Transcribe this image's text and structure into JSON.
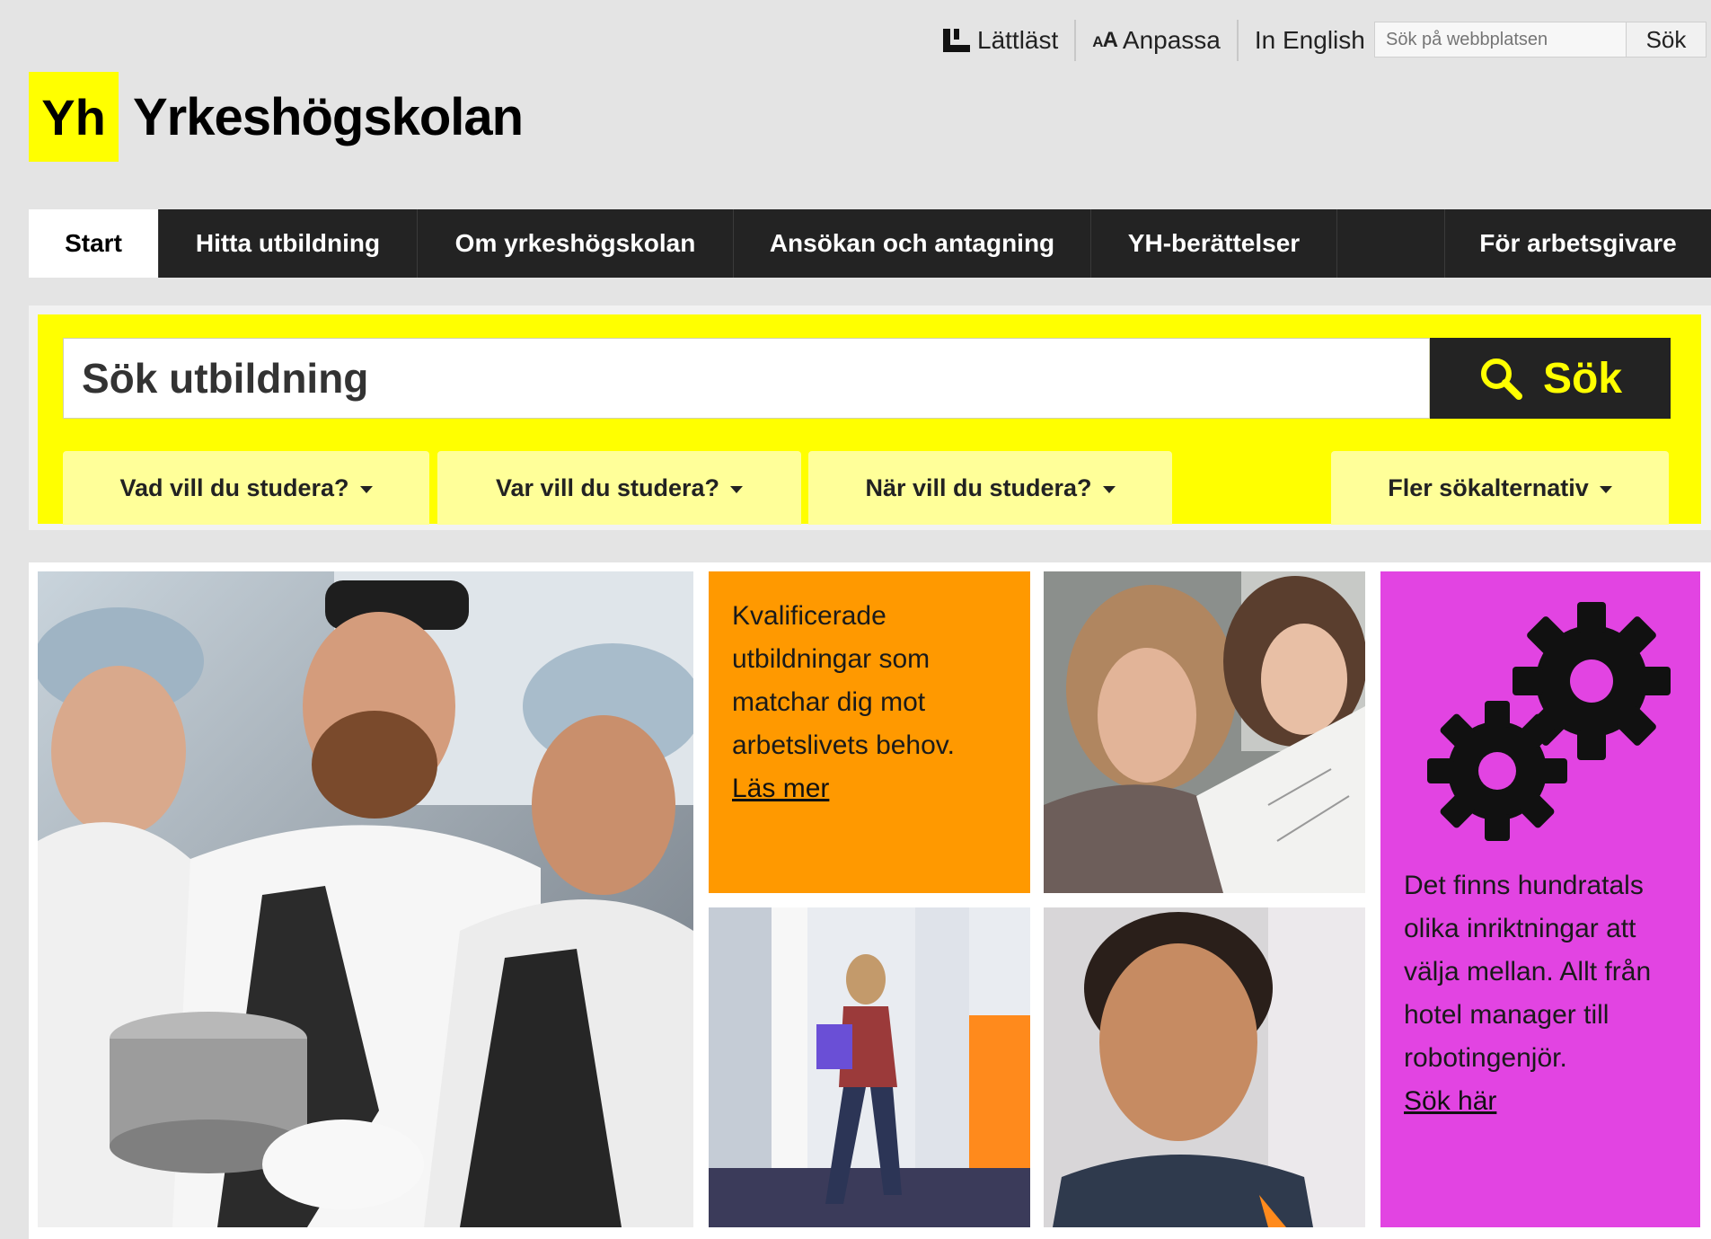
{
  "utility": {
    "easy_read": "Lättläst",
    "customize_prefix": "AA",
    "customize": "Anpassa",
    "english": "In English",
    "site_search_placeholder": "Sök på webbplatsen",
    "site_search_button": "Sök"
  },
  "logo": {
    "mark": "Yh",
    "name": "Yrkeshögskolan"
  },
  "nav": {
    "items": [
      {
        "label": "Start"
      },
      {
        "label": "Hitta utbildning"
      },
      {
        "label": "Om yrkeshögskolan"
      },
      {
        "label": "Ansökan och antagning"
      },
      {
        "label": "YH-berättelser"
      },
      {
        "label": ""
      },
      {
        "label": "För arbetsgivare"
      }
    ]
  },
  "search": {
    "placeholder": "Sök utbildning",
    "button": "Sök",
    "filters": [
      {
        "label": "Vad vill du studera?"
      },
      {
        "label": "Var vill du studera?"
      },
      {
        "label": "När vill du studera?"
      },
      {
        "label": "Fler sökalternativ"
      }
    ]
  },
  "tiles": {
    "orange": {
      "text": "Kvalificerade utbildningar som matchar dig mot arbetslivets behov.",
      "link": "Läs mer",
      "color": "#ff9900"
    },
    "magenta": {
      "icon": "gears-icon",
      "text": "Det finns hundratals olika inriktningar att välja mellan. Allt från hotel manager till robotingenjör.",
      "link": "Sök här",
      "color": "#e244e2"
    }
  },
  "colors": {
    "brand_yellow": "#ffff00",
    "nav_dark": "#232323",
    "filter_yellow": "#ffff99"
  }
}
